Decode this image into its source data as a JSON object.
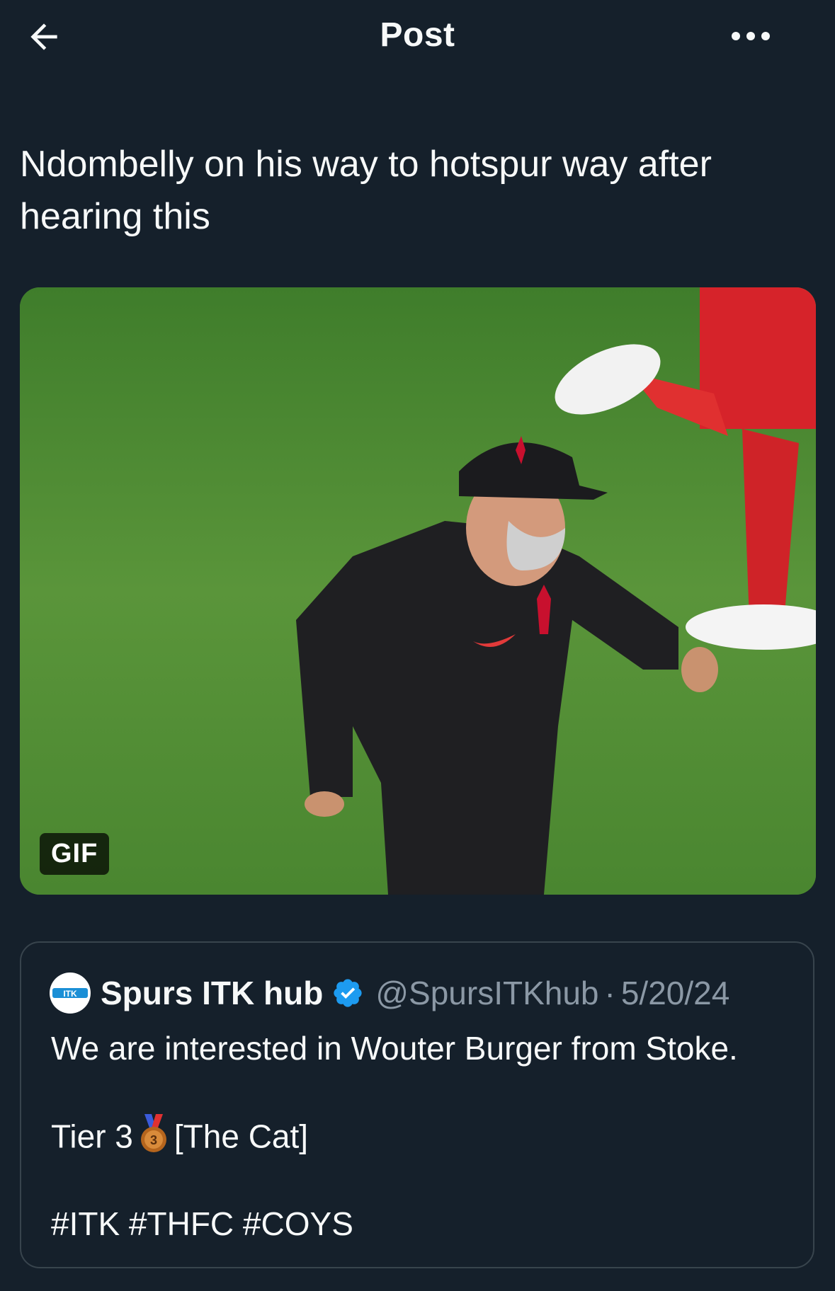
{
  "header": {
    "title": "Post",
    "back_icon": "arrow-left-icon",
    "more_icon": "more-horizontal-icon"
  },
  "post": {
    "text": "Ndombelly on his way to hotspur way after hearing this",
    "media": {
      "type": "gif",
      "badge": "GIF"
    }
  },
  "quoted_post": {
    "avatar_text": "ITK",
    "author_name": "Spurs ITK hub",
    "verified": true,
    "handle": "@SpursITKhub",
    "separator": "·",
    "date": "5/20/24",
    "line1": "We are interested in Wouter Burger from Stoke.",
    "tier_prefix": "Tier 3",
    "tier_icon": "third-place-medal-icon",
    "tier_suffix": "[The Cat]",
    "hashtags": "#ITK #THFC #COYS"
  },
  "colors": {
    "background": "#15202b",
    "text": "#f7f9f9",
    "muted": "#8b98a5",
    "border": "#38444d",
    "verified": "#1d9bf0"
  }
}
